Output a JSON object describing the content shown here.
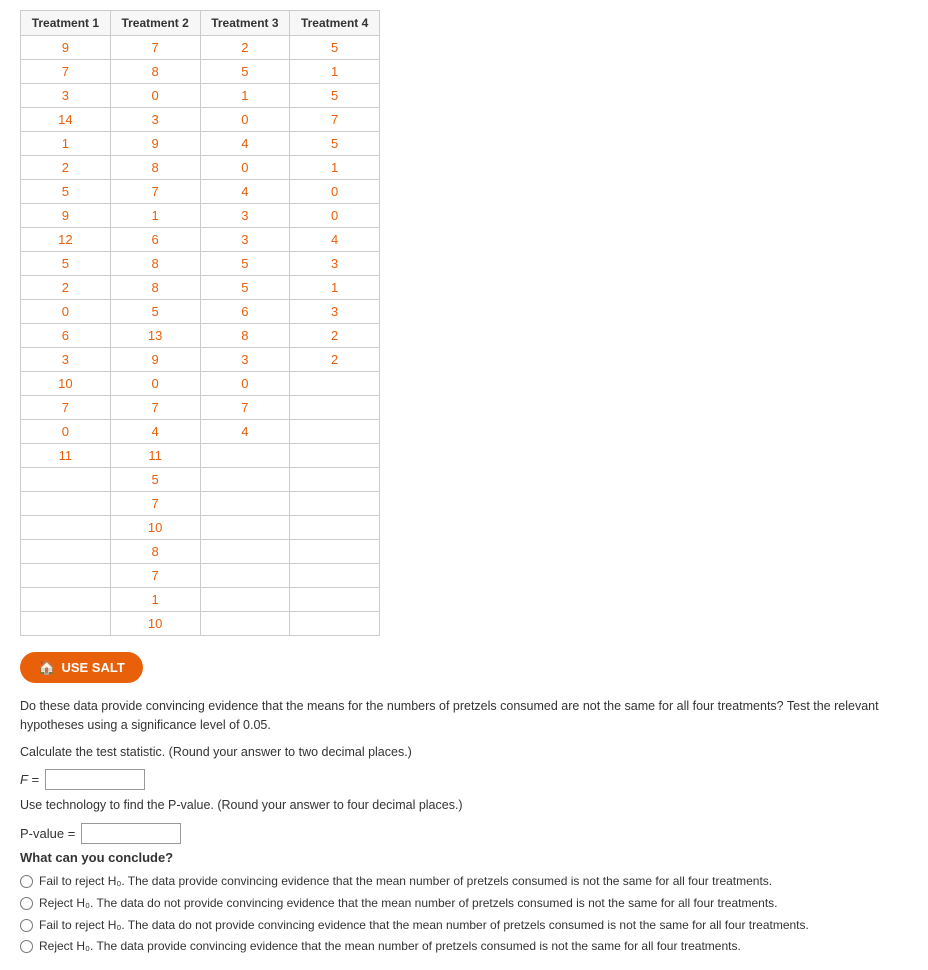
{
  "table": {
    "headers": [
      "Treatment 1",
      "Treatment 2",
      "Treatment 3",
      "Treatment 4"
    ],
    "rows": [
      [
        "9",
        "7",
        "2",
        "5"
      ],
      [
        "7",
        "8",
        "5",
        "1"
      ],
      [
        "3",
        "0",
        "1",
        "5"
      ],
      [
        "14",
        "3",
        "0",
        "7"
      ],
      [
        "1",
        "9",
        "4",
        "5"
      ],
      [
        "2",
        "8",
        "0",
        "1"
      ],
      [
        "5",
        "7",
        "4",
        "0"
      ],
      [
        "9",
        "1",
        "3",
        "0"
      ],
      [
        "12",
        "6",
        "3",
        "4"
      ],
      [
        "5",
        "8",
        "5",
        "3"
      ],
      [
        "2",
        "8",
        "5",
        "1"
      ],
      [
        "0",
        "5",
        "6",
        "3"
      ],
      [
        "6",
        "13",
        "8",
        "2"
      ],
      [
        "3",
        "9",
        "3",
        "2"
      ],
      [
        "10",
        "0",
        "0",
        ""
      ],
      [
        "7",
        "7",
        "7",
        ""
      ],
      [
        "0",
        "4",
        "4",
        ""
      ],
      [
        "11",
        "11",
        "",
        ""
      ],
      [
        "",
        "5",
        "",
        ""
      ],
      [
        "",
        "7",
        "",
        ""
      ],
      [
        "",
        "10",
        "",
        ""
      ],
      [
        "",
        "8",
        "",
        ""
      ],
      [
        "",
        "7",
        "",
        ""
      ],
      [
        "",
        "1",
        "",
        ""
      ],
      [
        "",
        "10",
        "",
        ""
      ]
    ]
  },
  "use_salt_button": "USE SALT",
  "question": "Do these data provide convincing evidence that the means for the numbers of pretzels consumed are not the same for all four treatments? Test the relevant hypotheses using a significance level of 0.05.",
  "calculate_label": "Calculate the test statistic. (Round your answer to two decimal places.)",
  "f_label": "F =",
  "f_placeholder": "",
  "technology_label": "Use technology to find the P-value. (Round your answer to four decimal places.)",
  "pvalue_label": "P-value =",
  "pvalue_placeholder": "",
  "conclude_label": "What can you conclude?",
  "radio_options": [
    {
      "id": "r1",
      "text": "Fail to reject H₀. The data provide convincing evidence that the mean number of pretzels consumed is not the same for all four treatments."
    },
    {
      "id": "r2",
      "text": "Reject H₀. The data do not provide convincing evidence that the mean number of pretzels consumed is not the same for all four treatments."
    },
    {
      "id": "r3",
      "text": "Fail to reject H₀. The data do not provide convincing evidence that the mean number of pretzels consumed is not the same for all four treatments."
    },
    {
      "id": "r4",
      "text": "Reject H₀. The data provide convincing evidence that the mean number of pretzels consumed is not the same for all four treatments."
    }
  ]
}
